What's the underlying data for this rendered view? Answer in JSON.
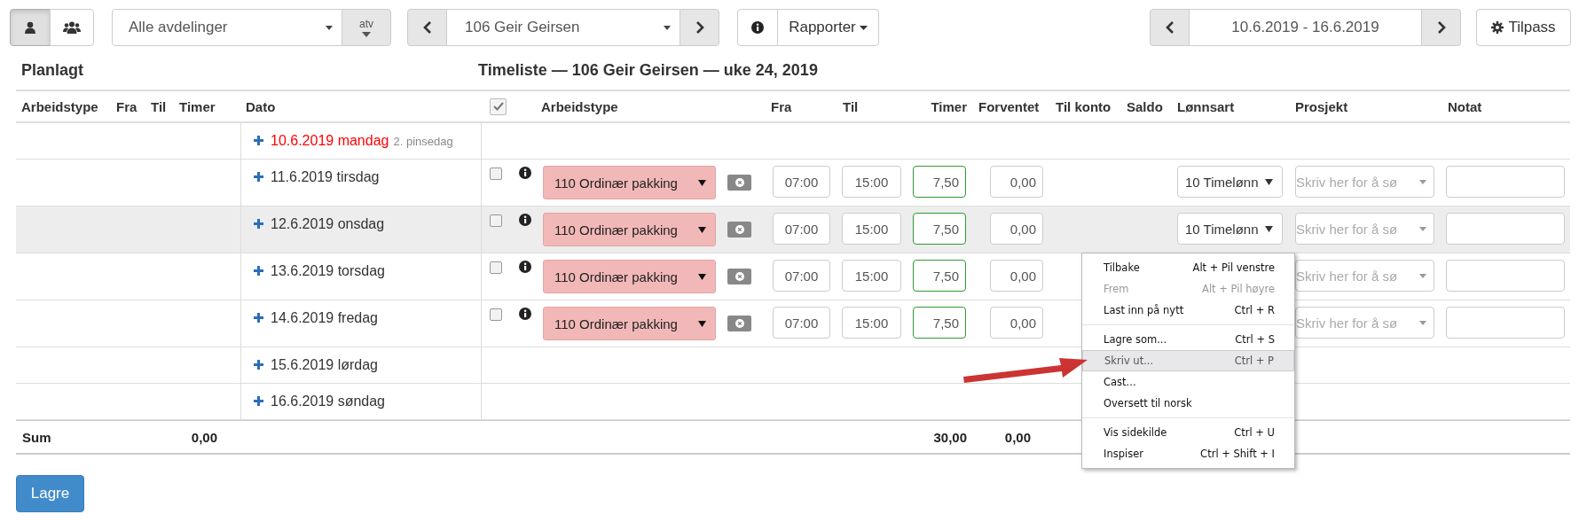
{
  "toolbar": {
    "view_buttons": [
      {
        "kind": "single",
        "selected": true
      },
      {
        "kind": "group",
        "selected": false
      }
    ],
    "department": "Alle avdelinger",
    "filter_button": "atv",
    "employee": "106 Geir Geirsen",
    "reports": "Rapporter",
    "date_range": "10.6.2019 - 16.6.2019",
    "customize": "Tilpass"
  },
  "headings": {
    "planned": "Planlagt",
    "timesheet": "Timeliste — 106 Geir Geirsen — uke 24, 2019"
  },
  "table": {
    "planned_columns": [
      "Arbeidstype",
      "Fra",
      "Til",
      "Timer"
    ],
    "date_column": "Dato",
    "select_all_checked": true,
    "timesheet_columns": [
      "Arbeidstype",
      "Fra",
      "Til",
      "Timer",
      "Forventet",
      "Til konto",
      "Saldo",
      "Lønnsart",
      "Prosjekt",
      "Notat"
    ],
    "days": [
      {
        "date": "10.6.2019 mandag",
        "holiday": true,
        "note": "2. pinsedag",
        "highlighted": false
      },
      {
        "date": "11.6.2019 tirsdag",
        "holiday": false,
        "highlighted": false,
        "entry": {
          "checked": false,
          "work_type": "110 Ordinær pakking",
          "from": "07:00",
          "to": "15:00",
          "hours": "7,50",
          "expected": "0,00",
          "wage_type": "10 Timelønn",
          "project_placeholder": "Skriv her for å sø"
        }
      },
      {
        "date": "12.6.2019 onsdag",
        "holiday": false,
        "highlighted": true,
        "entry": {
          "checked": false,
          "work_type": "110 Ordinær pakking",
          "from": "07:00",
          "to": "15:00",
          "hours": "7,50",
          "expected": "0,00",
          "wage_type": "10 Timelønn",
          "project_placeholder": "Skriv her for å sø"
        }
      },
      {
        "date": "13.6.2019 torsdag",
        "holiday": false,
        "highlighted": false,
        "entry": {
          "checked": false,
          "work_type": "110 Ordinær pakking",
          "from": "07:00",
          "to": "15:00",
          "hours": "7,50",
          "expected": "0,00",
          "project_placeholder": "Skriv her for å sø"
        }
      },
      {
        "date": "14.6.2019 fredag",
        "holiday": false,
        "highlighted": false,
        "entry": {
          "checked": false,
          "work_type": "110 Ordinær pakking",
          "from": "07:00",
          "to": "15:00",
          "hours": "7,50",
          "expected": "0,00",
          "project_placeholder": "Skriv her for å sø"
        }
      },
      {
        "date": "15.6.2019 lørdag",
        "holiday": false,
        "highlighted": false
      },
      {
        "date": "16.6.2019 søndag",
        "holiday": false,
        "highlighted": false
      }
    ],
    "sum": {
      "label": "Sum",
      "planned_hours": "0,00",
      "hours": "30,00",
      "expected": "0,00"
    }
  },
  "save_button": "Lagre",
  "context_menu": {
    "groups": [
      [
        {
          "label": "Tilbake",
          "shortcut": "Alt + Pil venstre",
          "disabled": false,
          "selected": false
        },
        {
          "label": "Frem",
          "shortcut": "Alt + Pil høyre",
          "disabled": true,
          "selected": false
        },
        {
          "label": "Last inn på nytt",
          "shortcut": "Ctrl + R",
          "disabled": false,
          "selected": false
        }
      ],
      [
        {
          "label": "Lagre som...",
          "shortcut": "Ctrl + S",
          "disabled": false,
          "selected": false
        },
        {
          "label": "Skriv ut...",
          "shortcut": "Ctrl + P",
          "disabled": false,
          "selected": true
        },
        {
          "label": "Cast...",
          "disabled": false,
          "selected": false
        },
        {
          "label": "Oversett til norsk",
          "disabled": false,
          "selected": false
        }
      ],
      [
        {
          "label": "Vis sidekilde",
          "shortcut": "Ctrl + U",
          "disabled": false,
          "selected": false
        },
        {
          "label": "Inspiser",
          "shortcut": "Ctrl + Shift + I",
          "disabled": false,
          "selected": false
        }
      ]
    ]
  }
}
